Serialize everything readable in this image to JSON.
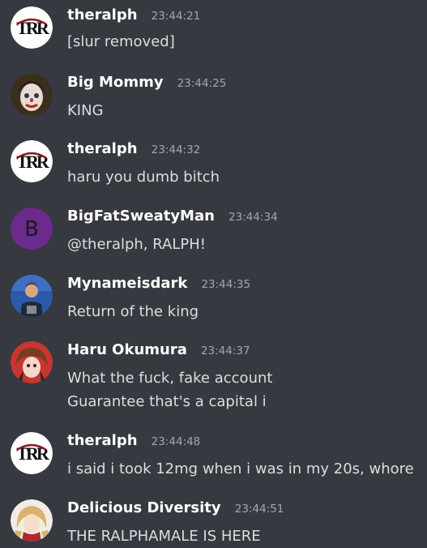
{
  "messages": [
    {
      "author": "theralph",
      "timestamp": "23:44:21",
      "avatar_icon": "theralph-logo-icon",
      "lines": [
        "[slur removed]"
      ]
    },
    {
      "author": "Big Mommy",
      "timestamp": "23:44:25",
      "avatar_icon": "clown-face-avatar",
      "lines": [
        "KING"
      ]
    },
    {
      "author": "theralph",
      "timestamp": "23:44:32",
      "avatar_icon": "theralph-logo-icon",
      "lines": [
        "haru you dumb bitch"
      ]
    },
    {
      "author": "BigFatSweatyMan",
      "timestamp": "23:44:34",
      "avatar_icon": "letter-b-avatar",
      "avatar_letter": "B",
      "avatar_color": "#6b2a8c",
      "lines": [
        "@theralph, RALPH!"
      ]
    },
    {
      "author": "Mynameisdark",
      "timestamp": "23:44:35",
      "avatar_icon": "speaker-photo-avatar",
      "lines": [
        "Return of the king"
      ]
    },
    {
      "author": "Haru Okumura",
      "timestamp": "23:44:37",
      "avatar_icon": "anime-girl-avatar",
      "lines": [
        "What the fuck, fake account",
        "Guarantee that's a capital i"
      ]
    },
    {
      "author": "theralph",
      "timestamp": "23:44:48",
      "avatar_icon": "theralph-logo-icon",
      "lines": [
        "i said i took 12mg when i was in my 20s, whore"
      ]
    },
    {
      "author": "Delicious Diversity",
      "timestamp": "23:44:51",
      "avatar_icon": "anime-blonde-avatar",
      "lines": [
        "THE RALPHAMALE IS HERE"
      ]
    }
  ],
  "colors": {
    "background": "#36393f",
    "username": "#ffffff",
    "message_text": "#dcddde",
    "timestamp": "#a3a6aa"
  }
}
